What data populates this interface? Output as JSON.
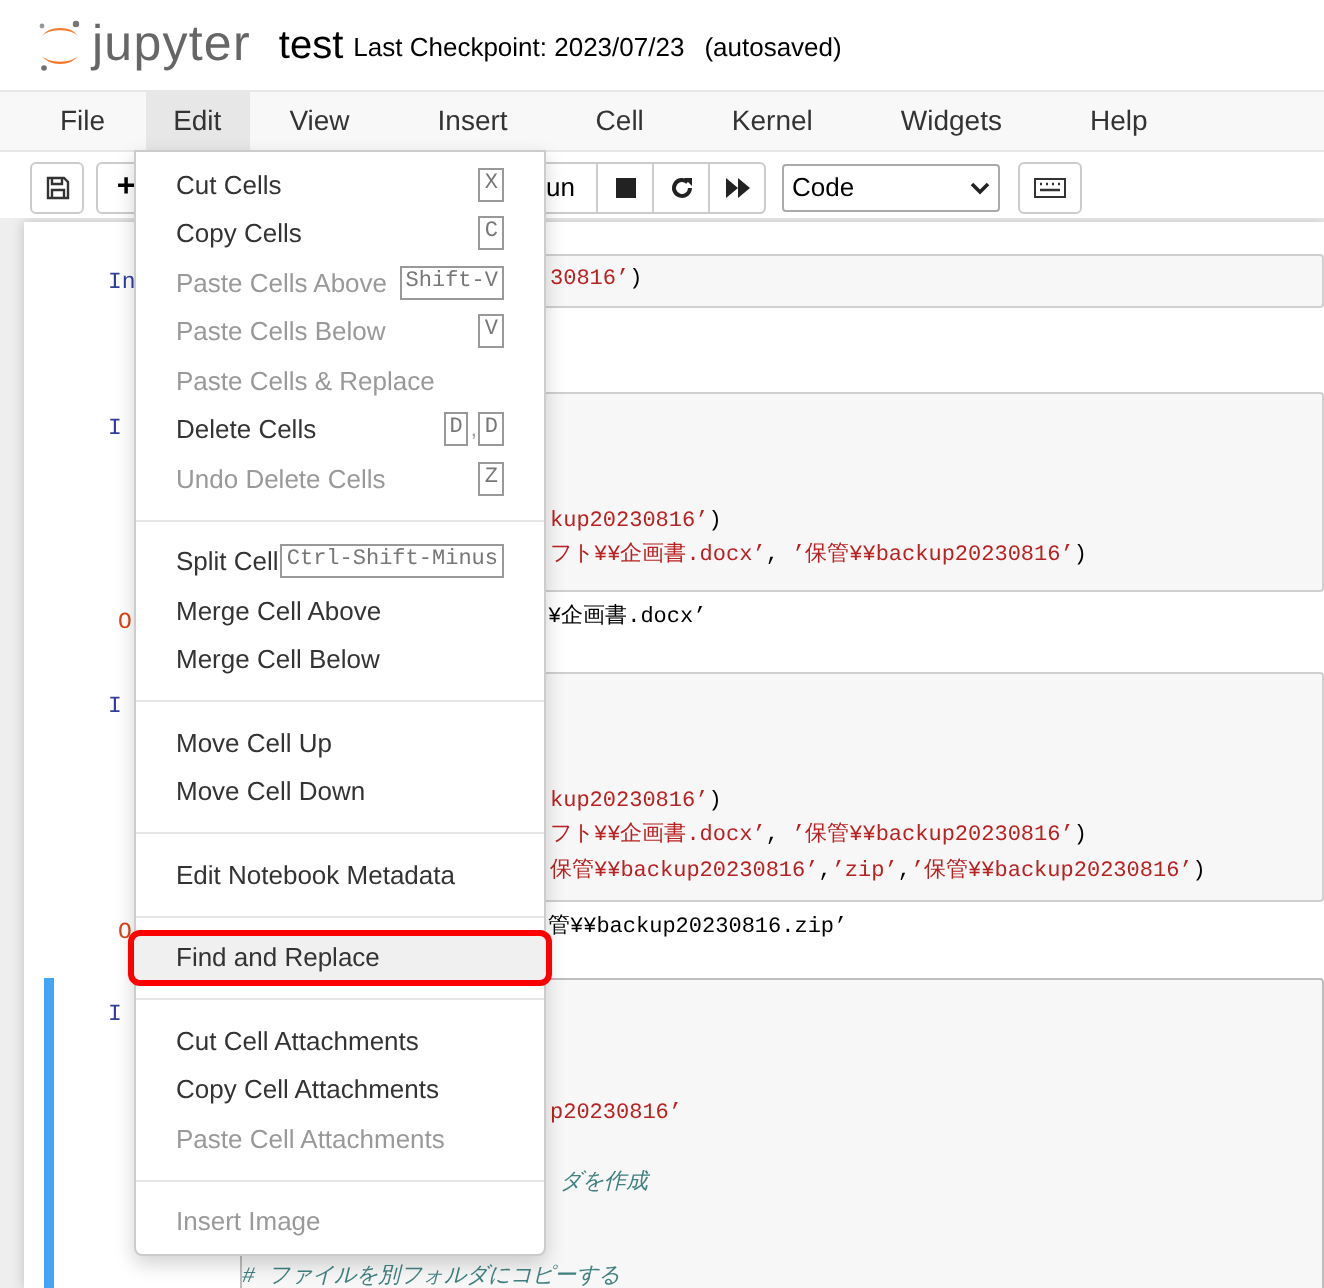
{
  "header": {
    "logo_text": "jupyter",
    "notebook_name": "test",
    "checkpoint": "Last Checkpoint: 2023/07/23",
    "save_status": "(autosaved)"
  },
  "menubar": [
    {
      "label": "File",
      "selected": false
    },
    {
      "label": "Edit",
      "selected": true
    },
    {
      "label": "View",
      "selected": false
    },
    {
      "label": "Insert",
      "selected": false
    },
    {
      "label": "Cell",
      "selected": false
    },
    {
      "label": "Kernel",
      "selected": false
    },
    {
      "label": "Widgets",
      "selected": false
    },
    {
      "label": "Help",
      "selected": false
    }
  ],
  "toolbar": {
    "add_label": "+",
    "run_label": "un",
    "cell_type": "Code"
  },
  "cells": [
    {
      "prompt": "In",
      "kind": "input",
      "selected": false,
      "lines": [
        [
          {
            "kind": "string",
            "text": "30816’"
          },
          {
            "kind": "plain",
            "text": ")"
          }
        ]
      ]
    },
    {
      "prompt": "I",
      "kind": "input",
      "selected": false,
      "lines": [
        [
          {
            "kind": "string",
            "text": "kup20230816’"
          },
          {
            "kind": "plain",
            "text": ")"
          }
        ],
        [
          {
            "kind": "string",
            "text": "フト¥¥企画書.docx’"
          },
          {
            "kind": "plain",
            "text": ", "
          },
          {
            "kind": "string",
            "text": "’保管¥¥backup20230816’"
          },
          {
            "kind": "plain",
            "text": ")"
          }
        ]
      ]
    },
    {
      "prompt": "O",
      "kind": "output",
      "selected": false,
      "lines": [
        [
          {
            "kind": "plain",
            "text": "¥企画書.docx’"
          }
        ]
      ]
    },
    {
      "prompt": "I",
      "kind": "input",
      "selected": false,
      "lines": [
        [
          {
            "kind": "string",
            "text": "kup20230816’"
          },
          {
            "kind": "plain",
            "text": ")"
          }
        ],
        [
          {
            "kind": "string",
            "text": "フト¥¥企画書.docx’"
          },
          {
            "kind": "plain",
            "text": ", "
          },
          {
            "kind": "string",
            "text": "’保管¥¥backup20230816’"
          },
          {
            "kind": "plain",
            "text": ")"
          }
        ],
        [
          {
            "kind": "string",
            "text": "保管¥¥backup20230816’"
          },
          {
            "kind": "plain",
            "text": ","
          },
          {
            "kind": "string",
            "text": "’zip’"
          },
          {
            "kind": "plain",
            "text": ","
          },
          {
            "kind": "string",
            "text": "’保管¥¥backup20230816’"
          },
          {
            "kind": "plain",
            "text": ")"
          }
        ]
      ]
    },
    {
      "prompt": "O",
      "kind": "output",
      "selected": false,
      "lines": [
        [
          {
            "kind": "plain",
            "text": "管¥¥backup20230816.zip’"
          }
        ]
      ]
    },
    {
      "prompt": "I",
      "kind": "input",
      "selected": true,
      "lines": [
        [
          {
            "kind": "string",
            "text": "p20230816’"
          }
        ],
        [
          {
            "kind": "comment",
            "text": "ダを作成"
          }
        ],
        [
          {
            "kind": "comment",
            "text": "# ファイルを別フォルダにコピーする"
          }
        ]
      ]
    }
  ],
  "edit_menu": [
    {
      "kind": "item",
      "label": "Cut Cells",
      "keys": [
        "X"
      ],
      "disabled": false,
      "highlighted": false
    },
    {
      "kind": "item",
      "label": "Copy Cells",
      "keys": [
        "C"
      ],
      "disabled": false,
      "highlighted": false
    },
    {
      "kind": "item",
      "label": "Paste Cells Above",
      "keys": [
        "Shift-V"
      ],
      "disabled": true,
      "highlighted": false
    },
    {
      "kind": "item",
      "label": "Paste Cells Below",
      "keys": [
        "V"
      ],
      "disabled": true,
      "highlighted": false
    },
    {
      "kind": "item",
      "label": "Paste Cells & Replace",
      "disabled": true,
      "highlighted": false
    },
    {
      "kind": "item",
      "label": "Delete Cells",
      "keys": [
        "D",
        "D"
      ],
      "key_separator": ",",
      "disabled": false,
      "highlighted": false
    },
    {
      "kind": "item",
      "label": "Undo Delete Cells",
      "keys": [
        "Z"
      ],
      "disabled": true,
      "highlighted": false
    },
    {
      "kind": "divider"
    },
    {
      "kind": "item",
      "label": "Split Cell",
      "keys": [
        "Ctrl-Shift-Minus"
      ],
      "disabled": false,
      "highlighted": false
    },
    {
      "kind": "item",
      "label": "Merge Cell Above",
      "disabled": false,
      "highlighted": false
    },
    {
      "kind": "item",
      "label": "Merge Cell Below",
      "disabled": false,
      "highlighted": false
    },
    {
      "kind": "divider"
    },
    {
      "kind": "item",
      "label": "Move Cell Up",
      "disabled": false,
      "highlighted": false
    },
    {
      "kind": "item",
      "label": "Move Cell Down",
      "disabled": false,
      "highlighted": false
    },
    {
      "kind": "divider"
    },
    {
      "kind": "item",
      "label": "Edit Notebook Metadata",
      "disabled": false,
      "highlighted": false
    },
    {
      "kind": "divider"
    },
    {
      "kind": "item",
      "label": "Find and Replace",
      "disabled": false,
      "highlighted": true,
      "annotated": true
    },
    {
      "kind": "divider"
    },
    {
      "kind": "item",
      "label": "Cut Cell Attachments",
      "disabled": false,
      "highlighted": false
    },
    {
      "kind": "item",
      "label": "Copy Cell Attachments",
      "disabled": false,
      "highlighted": false
    },
    {
      "kind": "item",
      "label": "Paste Cell Attachments",
      "disabled": true,
      "highlighted": false
    },
    {
      "kind": "divider"
    },
    {
      "kind": "item",
      "label": "Insert Image",
      "disabled": true,
      "highlighted": false
    }
  ]
}
